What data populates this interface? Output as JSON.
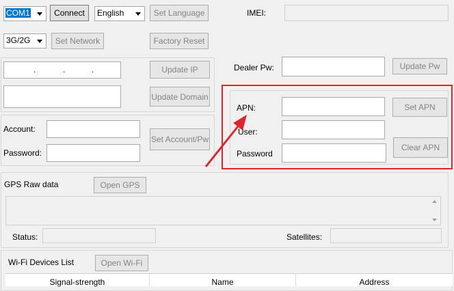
{
  "top": {
    "port_combo": "COM1",
    "connect": "Connect",
    "language_combo": "English",
    "set_language": "Set Language",
    "imei_label": "IMEI:",
    "imei_value": ""
  },
  "network": {
    "mode_combo": "3G/2G",
    "set_network": "Set Network",
    "factory_reset": "Factory Reset"
  },
  "server": {
    "ip_dots": [
      ".",
      ".",
      "."
    ],
    "update_ip": "Update IP",
    "domain_value": "",
    "update_domain": "Update Domain"
  },
  "dealer": {
    "label": "Dealer Pw:",
    "value": "",
    "update": "Update Pw"
  },
  "account": {
    "account_label": "Account:",
    "account_value": "",
    "password_label": "Password:",
    "password_value": "",
    "set_button": "Set Account/Pw"
  },
  "apn": {
    "apn_label": "APN:",
    "apn_value": "",
    "set_apn": "Set APN",
    "user_label": "User:",
    "user_value": "",
    "password_label": "Password",
    "password_value": "",
    "clear_apn": "Clear APN",
    "highlight_color": "#e0262c"
  },
  "gps": {
    "title": "GPS Raw data",
    "open": "Open GPS",
    "raw_data": "",
    "status_label": "Status:",
    "status_value": "",
    "satellites_label": "Satellites:",
    "satellites_value": ""
  },
  "wifi": {
    "title": "Wi-Fi Devices List",
    "open": "Open Wi-Fi",
    "columns": [
      "Signal-strength",
      "Name",
      "Address"
    ]
  },
  "icons": {
    "dropdown": "chevron-down-icon",
    "scroll_up": "scroll-up-arrow-icon",
    "scroll_down": "scroll-down-arrow-icon",
    "annotation": "red-arrow-icon"
  }
}
